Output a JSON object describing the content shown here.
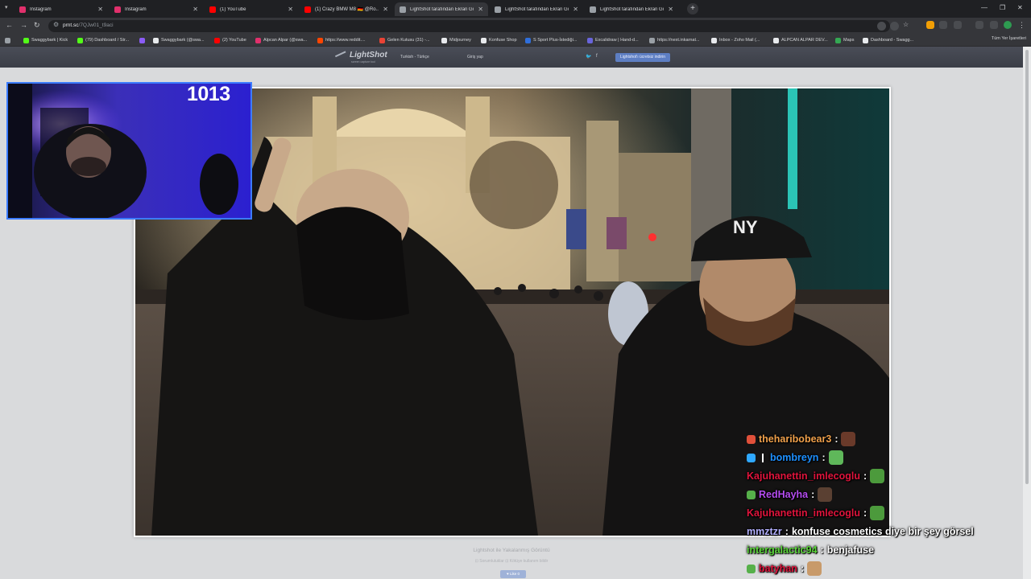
{
  "browser": {
    "tabs": [
      {
        "title": "Instagram",
        "icon": "instagram-icon",
        "color": "#e1306c"
      },
      {
        "title": "Instagram",
        "icon": "instagram-icon",
        "color": "#e1306c"
      },
      {
        "title": "(1) YouTube",
        "icon": "youtube-icon",
        "color": "#ff0000"
      },
      {
        "title": "(1) Crazy BMW M8 🇩🇪 @Ro...",
        "icon": "youtube-icon",
        "color": "#ff0000"
      },
      {
        "title": "LightShot tarafından Ekran Gör...",
        "icon": "feather-icon",
        "color": "#9aa0a6"
      },
      {
        "title": "LightShot tarafından Ekran Gör...",
        "icon": "feather-icon",
        "color": "#9aa0a6"
      },
      {
        "title": "LightShot tarafından Ekran Gör...",
        "icon": "feather-icon",
        "color": "#9aa0a6"
      }
    ],
    "url_host": "prnt.sc",
    "url_path": "/7QJw01_t9aci",
    "bookmarks": [
      {
        "label": "Swaggybark | Kick",
        "color": "#53fc18"
      },
      {
        "label": "(79) Dashboard / Str...",
        "color": "#53fc18"
      },
      {
        "label": "",
        "color": "#8b5cf6"
      },
      {
        "label": "Swaggybark (@swa...",
        "color": "#e8eaed"
      },
      {
        "label": "(2) YouTube",
        "color": "#ff0000"
      },
      {
        "label": "Alpcan Alpar (@swa...",
        "color": "#e1306c"
      },
      {
        "label": "https://www.reddit....",
        "color": "#ff4500"
      },
      {
        "label": "Gelen Kutusu (31) -...",
        "color": "#ea4335"
      },
      {
        "label": "Midjourney",
        "color": "#e8eaed"
      },
      {
        "label": "Konfuse Shop",
        "color": "#e8eaed"
      },
      {
        "label": "S Sport Plus-İstediği...",
        "color": "#2f6fdb"
      },
      {
        "label": "Excalidraw | Hand-d...",
        "color": "#6965db"
      },
      {
        "label": "https://next.inkarnat...",
        "color": "#9aa0a6"
      },
      {
        "label": "Inbox - Zoho Mail (...",
        "color": "#e8eaed"
      },
      {
        "label": "ALPCAN ALPAR DEV...",
        "color": "#e8eaed"
      },
      {
        "label": "Maps",
        "color": "#34a853"
      },
      {
        "label": "Dashboard - Swagg...",
        "color": "#e8eaed"
      }
    ],
    "all_bookmarks": "Tüm Yer İşaretleri"
  },
  "lightshot": {
    "logo": "LightShot",
    "logo_sub": "screen capture tool",
    "language": "Turkish - Türkçe",
    "login": "Giriş yap",
    "download_button": "Lightshot'ı ücretsiz indirin",
    "caption": "Lightshot ile Yakalanmış Görüntü",
    "caption_links": "⊡ Sorumluluklar  ⊡ Kötüye kullanım bildir",
    "like_button": "♥ Like 0"
  },
  "stream": {
    "counter": "1013",
    "chat": [
      {
        "badge": "#e0503a",
        "user": "theharibobear3",
        "color": "#f0a04b",
        "message": "",
        "emote": "#6a3a2a"
      },
      {
        "badge": "#2fa8ff",
        "extra_badge": "#ffffff",
        "user": "bombreyn",
        "color": "#1e90ff",
        "message": "",
        "emote": "#5fb85a"
      },
      {
        "badge": "",
        "user": "Kajuhanettin_imlecoglu",
        "color": "#e0143c",
        "message": "",
        "emote": "#4c9a3c"
      },
      {
        "badge": "#56b04a",
        "user": "RedHayha",
        "color": "#b44cf0",
        "message": "",
        "emote": "#5a4032"
      },
      {
        "badge": "",
        "user": "Kajuhanettin_imlecoglu",
        "color": "#e0143c",
        "message": "",
        "emote": "#4c9a3c"
      },
      {
        "badge": "",
        "user": "mmztzr",
        "color": "#b3b0ff",
        "message": "konfuse cosmetics diye bir şey görsel",
        "emote": ""
      },
      {
        "badge": "",
        "user": "intergalactic94",
        "color": "#5bd63a",
        "message": "benjafuse",
        "emote": ""
      },
      {
        "badge": "#56b04a",
        "user": "batyhan",
        "color": "#e0143c",
        "message": "",
        "emote": "#c89a6a"
      }
    ]
  }
}
